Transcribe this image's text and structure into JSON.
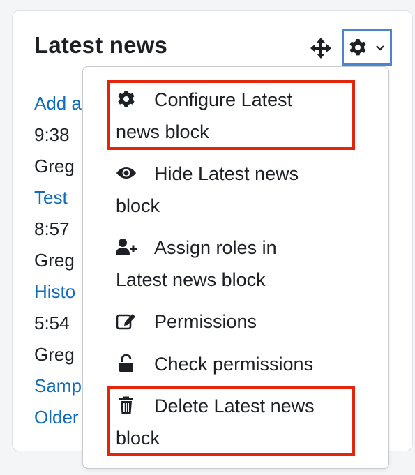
{
  "block": {
    "title": "Latest news",
    "move_icon": "move-arrows-icon",
    "actions_icon": "gear-icon",
    "caret_icon": "chevron-down-icon"
  },
  "news": [
    {
      "text": "Add a",
      "type": "link"
    },
    {
      "text": "9:38",
      "type": "text"
    },
    {
      "text": "Greg",
      "type": "text"
    },
    {
      "text": "Test",
      "type": "link"
    },
    {
      "text": "8:57",
      "type": "text"
    },
    {
      "text": "Greg",
      "type": "text"
    },
    {
      "text": "Histo",
      "type": "link"
    },
    {
      "text": "5:54",
      "type": "text"
    },
    {
      "text": "Greg",
      "type": "text"
    },
    {
      "text": "Samp",
      "type": "link"
    },
    {
      "text": "Older",
      "type": "link"
    }
  ],
  "menu": {
    "items": [
      {
        "label_line1": "Configure Latest",
        "label_line2": "news block",
        "icon": "gear-icon",
        "highlighted": true
      },
      {
        "label_line1": "Hide Latest news",
        "label_line2": "block",
        "icon": "eye-icon",
        "highlighted": false
      },
      {
        "label_line1": "Assign roles in",
        "label_line2": "Latest news block",
        "icon": "user-plus-icon",
        "highlighted": false
      },
      {
        "label_line1": "Permissions",
        "label_line2": "",
        "icon": "edit-icon",
        "highlighted": false
      },
      {
        "label_line1": "Check permissions",
        "label_line2": "",
        "icon": "unlock-icon",
        "highlighted": false
      },
      {
        "label_line1": "Delete Latest news",
        "label_line2": "block",
        "icon": "trash-icon",
        "highlighted": true
      }
    ]
  },
  "colors": {
    "link": "#0f6cbf",
    "text": "#1d2125",
    "highlight": "#e3260b",
    "focus_border": "#4a86d0"
  }
}
